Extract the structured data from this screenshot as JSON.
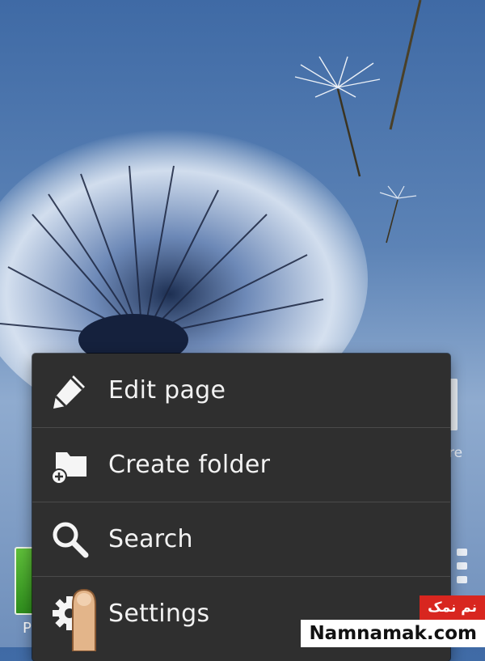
{
  "wallpaper": {
    "description_icon": "dandelion-wallpaper"
  },
  "menu": {
    "items": [
      {
        "label": "Edit page",
        "icon": "pencil-icon"
      },
      {
        "label": "Create folder",
        "icon": "folder-add-icon"
      },
      {
        "label": "Search",
        "icon": "search-icon"
      },
      {
        "label": "Settings",
        "icon": "gear-icon"
      }
    ]
  },
  "background": {
    "widget_label": "P",
    "right_label": "re"
  },
  "watermark": {
    "fa_text": "نم نمک",
    "en_text": "Namnamak.com",
    "accent": "#d8261f"
  },
  "colors": {
    "menu_bg": "#2f2f2f",
    "menu_divider": "#4a4a4a",
    "menu_text": "#f2f2f2"
  }
}
